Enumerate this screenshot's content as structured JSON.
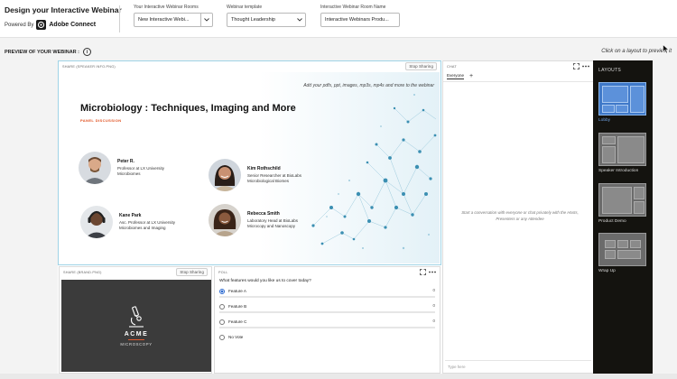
{
  "header": {
    "title": "Design your Interactive Webinar",
    "powered_by": "Powered By",
    "brand": "Adobe Connect",
    "rooms_label": "Your Interactive Webinar Rooms",
    "rooms_value": "New Interactive Webi...",
    "template_label": "Webinar template",
    "template_value": "Thought Leadership",
    "roomname_label": "Interactive Webinar Room Name",
    "roomname_value": "Interactive Webinars Produ..."
  },
  "preview": {
    "label": "PREVIEW OF YOUR WEBINAR :",
    "info_icon": "i",
    "hint": "Click on a layout to preview it"
  },
  "share_main": {
    "header": "SHARE (SPEAKER INFO.PNG)",
    "stop": "Stop Sharing",
    "hint": "Add your pdfs, ppt, images, mp3s, mp4s and more to the webinar",
    "title": "Microbiology : Techniques, Imaging and More",
    "subtitle": "PANEL DISCUSSION",
    "people": [
      {
        "name": "Peter R.",
        "line1": "Professor at LX University",
        "line2": "Microbiomes"
      },
      {
        "name": "Kim Rothschild",
        "line1": "Senior Researcher at BioLabs",
        "line2": "Microbiological Biomes"
      },
      {
        "name": "Kane Park",
        "line1": "Asc. Professor at LX University",
        "line2": "Microbiomes and Imaging"
      },
      {
        "name": "Rebecca Smith",
        "line1": "Laboratory Head at BioLabs",
        "line2": "Microcopy and Nanoscopy"
      }
    ]
  },
  "share_brand": {
    "header": "SHARE (BRAND.PNG)",
    "stop": "Stop Sharing",
    "logo_name": "ACME",
    "logo_sub": "MICROSCOPY"
  },
  "poll": {
    "header": "POLL",
    "question": "What features would you like us to cover today?",
    "options": [
      {
        "label": "Feature A",
        "count": "0"
      },
      {
        "label": "Feature B",
        "count": "0"
      },
      {
        "label": "Feature C",
        "count": "0"
      },
      {
        "label": "No Vote",
        "count": ""
      }
    ]
  },
  "chat": {
    "header": "CHAT",
    "tab": "Everyone",
    "plus": "+",
    "empty": "Start a conversation with everyone or chat privately with the Hosts, Presenters or any Attendee",
    "input_placeholder": "Type here"
  },
  "layouts": {
    "title": "LAYOUTS",
    "items": [
      "Lobby",
      "Speaker Introduction",
      "Product Demo",
      "Wrap Up"
    ]
  },
  "colors": {
    "accent": "#3f79c9",
    "selected_caption": "#6fa2e3",
    "subtitle_orange": "#e0501f",
    "layouts_bg": "#14130f"
  }
}
